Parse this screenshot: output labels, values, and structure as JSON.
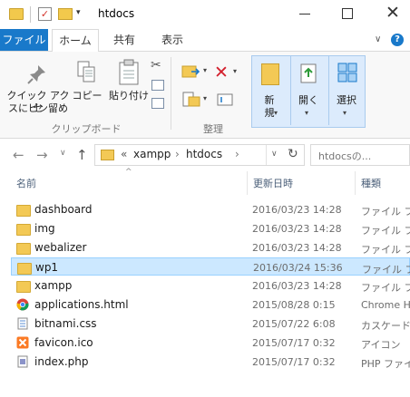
{
  "window": {
    "title": "htdocs"
  },
  "tabs": {
    "file": "ファイル",
    "home": "ホーム",
    "share": "共有",
    "view": "表示",
    "help": "?"
  },
  "ribbon": {
    "pin_label_1": "クイック アクセ",
    "pin_label_2": "スにピン留め",
    "copy_label": "コピー",
    "paste_label": "貼り付け",
    "clipboard_group": "クリップボード",
    "organize_group": "整理",
    "new_label_1": "新",
    "new_label_2": "規",
    "open_label": "開く",
    "select_label": "選択"
  },
  "address": {
    "chevrons": "«",
    "crumb_1": "xampp",
    "sep": "›",
    "crumb_2": "htdocs",
    "search_placeholder": "htdocsの..."
  },
  "columns": {
    "name": "名前",
    "date": "更新日時",
    "type": "種類"
  },
  "files": [
    {
      "name": "dashboard",
      "date": "2016/03/23 14:28",
      "type": "ファイル フォ",
      "icon": "folder-icon"
    },
    {
      "name": "img",
      "date": "2016/03/23 14:28",
      "type": "ファイル フォ",
      "icon": "folder-icon"
    },
    {
      "name": "webalizer",
      "date": "2016/03/23 14:28",
      "type": "ファイル フォ",
      "icon": "folder-icon"
    },
    {
      "name": "wp1",
      "date": "2016/03/24 15:36",
      "type": "ファイル フォ",
      "icon": "folder-icon"
    },
    {
      "name": "xampp",
      "date": "2016/03/23 14:28",
      "type": "ファイル フォ",
      "icon": "folder-icon"
    },
    {
      "name": "applications.html",
      "date": "2015/08/28 0:15",
      "type": "Chrome H",
      "icon": "chrome-icon"
    },
    {
      "name": "bitnami.css",
      "date": "2015/07/22 6:08",
      "type": "カスケード ス",
      "icon": "css-file-icon"
    },
    {
      "name": "favicon.ico",
      "date": "2015/07/17 0:32",
      "type": "アイコン",
      "icon": "xampp-icon"
    },
    {
      "name": "index.php",
      "date": "2015/07/17 0:32",
      "type": "PHP ファイ",
      "icon": "php-file-icon"
    }
  ],
  "colors": {
    "accent": "#1979ca",
    "selection": "#cce8ff",
    "folder": "#f3c955"
  }
}
